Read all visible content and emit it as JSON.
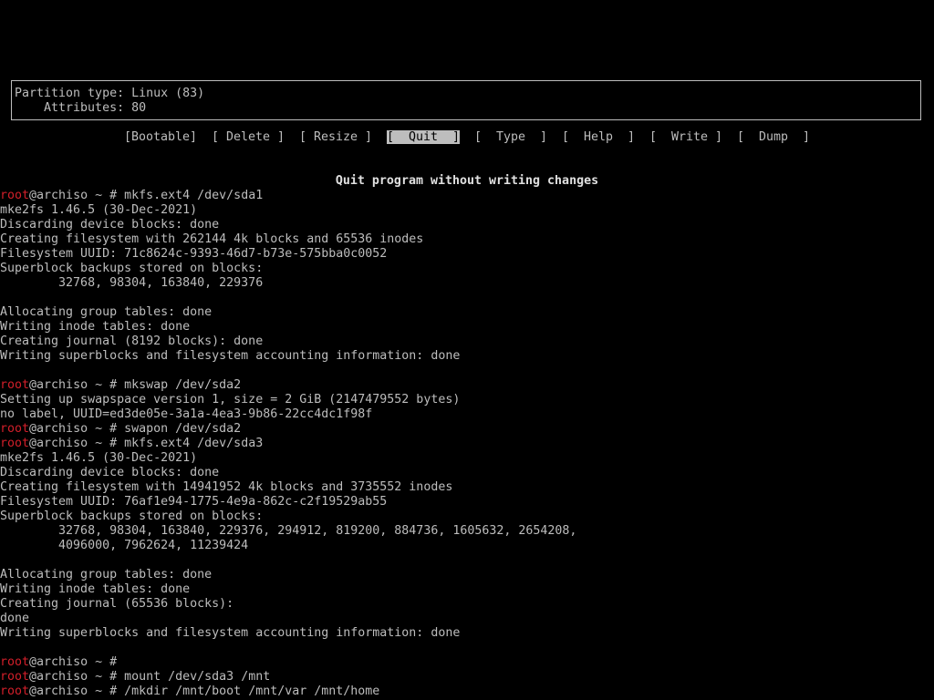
{
  "partition_info": {
    "type_line": "Partition type: Linux (83)",
    "attributes_line": "    Attributes: 80"
  },
  "menu": {
    "items": [
      {
        "label": "[Bootable]",
        "selected": false
      },
      {
        "label": "[ Delete ]",
        "selected": false
      },
      {
        "label": "[ Resize ]",
        "selected": false
      },
      {
        "label": "[  Quit  ]",
        "selected": true
      },
      {
        "label": "[  Type  ]",
        "selected": false
      },
      {
        "label": "[  Help  ]",
        "selected": false
      },
      {
        "label": "[  Write ]",
        "selected": false
      },
      {
        "label": "[  Dump  ]",
        "selected": false
      }
    ]
  },
  "hint": "Quit program without writing changes",
  "colors": {
    "background": "#000000",
    "text": "#bdbdbd",
    "user": "#d21f2a"
  },
  "terminal": {
    "lines": [
      {
        "user": "root",
        "text": "@archiso ~ # mkfs.ext4 /dev/sda1"
      },
      {
        "user": "",
        "text": "mke2fs 1.46.5 (30-Dec-2021)"
      },
      {
        "user": "",
        "text": "Discarding device blocks: done"
      },
      {
        "user": "",
        "text": "Creating filesystem with 262144 4k blocks and 65536 inodes"
      },
      {
        "user": "",
        "text": "Filesystem UUID: 71c8624c-9393-46d7-b73e-575bba0c0052"
      },
      {
        "user": "",
        "text": "Superblock backups stored on blocks:"
      },
      {
        "user": "",
        "text": "        32768, 98304, 163840, 229376"
      },
      {
        "user": "",
        "text": ""
      },
      {
        "user": "",
        "text": "Allocating group tables: done"
      },
      {
        "user": "",
        "text": "Writing inode tables: done"
      },
      {
        "user": "",
        "text": "Creating journal (8192 blocks): done"
      },
      {
        "user": "",
        "text": "Writing superblocks and filesystem accounting information: done"
      },
      {
        "user": "",
        "text": ""
      },
      {
        "user": "root",
        "text": "@archiso ~ # mkswap /dev/sda2"
      },
      {
        "user": "",
        "text": "Setting up swapspace version 1, size = 2 GiB (2147479552 bytes)"
      },
      {
        "user": "",
        "text": "no label, UUID=ed3de05e-3a1a-4ea3-9b86-22cc4dc1f98f"
      },
      {
        "user": "root",
        "text": "@archiso ~ # swapon /dev/sda2"
      },
      {
        "user": "root",
        "text": "@archiso ~ # mkfs.ext4 /dev/sda3"
      },
      {
        "user": "",
        "text": "mke2fs 1.46.5 (30-Dec-2021)"
      },
      {
        "user": "",
        "text": "Discarding device blocks: done"
      },
      {
        "user": "",
        "text": "Creating filesystem with 14941952 4k blocks and 3735552 inodes"
      },
      {
        "user": "",
        "text": "Filesystem UUID: 76af1e94-1775-4e9a-862c-c2f19529ab55"
      },
      {
        "user": "",
        "text": "Superblock backups stored on blocks:"
      },
      {
        "user": "",
        "text": "        32768, 98304, 163840, 229376, 294912, 819200, 884736, 1605632, 2654208,"
      },
      {
        "user": "",
        "text": "        4096000, 7962624, 11239424"
      },
      {
        "user": "",
        "text": ""
      },
      {
        "user": "",
        "text": "Allocating group tables: done"
      },
      {
        "user": "",
        "text": "Writing inode tables: done"
      },
      {
        "user": "",
        "text": "Creating journal (65536 blocks):"
      },
      {
        "user": "",
        "text": "done"
      },
      {
        "user": "",
        "text": "Writing superblocks and filesystem accounting information: done"
      },
      {
        "user": "",
        "text": ""
      },
      {
        "user": "root",
        "text": "@archiso ~ #"
      },
      {
        "user": "root",
        "text": "@archiso ~ # mount /dev/sda3 /mnt"
      },
      {
        "user": "root",
        "text": "@archiso ~ # /mkdir /mnt/boot /mnt/var /mnt/home"
      }
    ]
  }
}
